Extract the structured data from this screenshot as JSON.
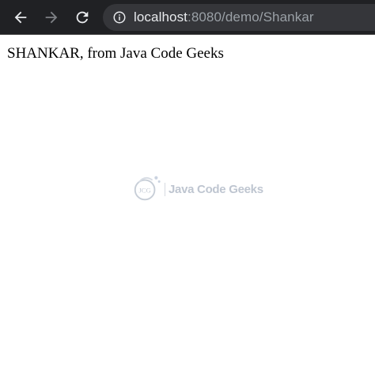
{
  "browser": {
    "url_host": "localhost",
    "url_rest": ":8080/demo/Shankar"
  },
  "page": {
    "greeting": "SHANKAR, from Java Code Geeks",
    "watermark_text": "Java Code Geeks",
    "watermark_logo_text": "JCG"
  },
  "icons": {
    "back": "arrow-left-icon",
    "forward": "arrow-right-icon",
    "reload": "reload-icon",
    "info": "info-icon"
  },
  "colors": {
    "toolbar": "#202124",
    "omnibox": "#35363a",
    "url_host": "#e8eaed",
    "url_rest": "#9aa0a6"
  }
}
